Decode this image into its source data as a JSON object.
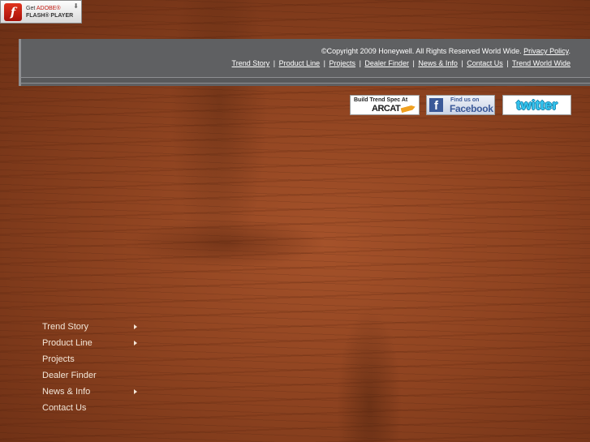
{
  "flash": {
    "line1_prefix": "Get ",
    "line1_brand": "ADOBE®",
    "line2": "FLASH® PLAYER",
    "icon": "flash-icon"
  },
  "footer": {
    "copyright": "©Copyright 2009 Honeywell. All Rights Reserved World Wide.",
    "privacy_link": "Privacy Policy",
    "privacy_suffix": ".",
    "links": [
      "Trend Story",
      "Product Line",
      "Projects",
      "Dealer Finder",
      "News & Info",
      "Contact Us",
      "Trend World Wide"
    ],
    "separator": "|"
  },
  "social": {
    "arcat_top": "Build Trend Spec At",
    "arcat_name": "ARCAT",
    "facebook_top": "Find us on",
    "facebook_name": "Facebook",
    "twitter_name": "twitter"
  },
  "side_nav": {
    "items": [
      {
        "label": "Trend Story",
        "submenu": true
      },
      {
        "label": "Product Line",
        "submenu": true
      },
      {
        "label": "Projects",
        "submenu": false
      },
      {
        "label": "Dealer Finder",
        "submenu": false
      },
      {
        "label": "News & Info",
        "submenu": true
      },
      {
        "label": "Contact Us",
        "submenu": false
      }
    ]
  }
}
